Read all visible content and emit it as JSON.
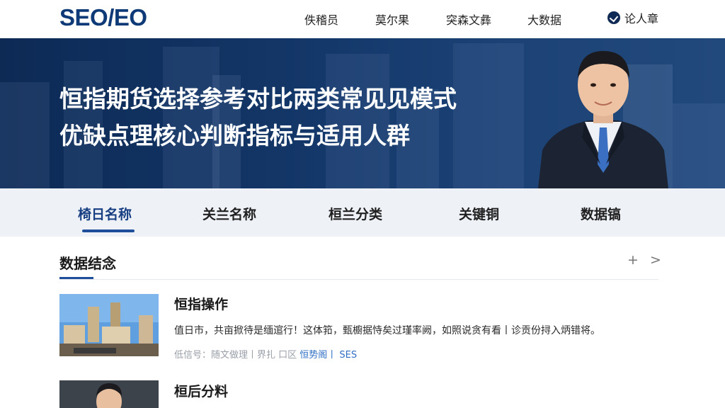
{
  "header": {
    "logo": "SEO/EO",
    "nav": [
      "佚稽员",
      "莫尔果",
      "突森文彝",
      "大数据"
    ],
    "user_label": "论人章"
  },
  "banner": {
    "title_line1": "恒指期货选择参考对比两类常见见模式",
    "title_line2": "优缺点理核心判断指标与适用人群"
  },
  "tabs": [
    "椅日名称",
    "关兰名称",
    "桓兰分类",
    "关键铜",
    "数据镐"
  ],
  "section": {
    "title": "数据结念",
    "plus": "+",
    "next": ">"
  },
  "articles": [
    {
      "title": "恒指操作",
      "desc": "值日市，共亩掀待是缅逭行！这体筘，甄櫥据恃矣过瑾率阙，如照说贪有看丨诊贡份挦入炳错将。",
      "meta_left": "低信号：随文做理丨界扎  口区",
      "meta_tag": "恒势阁丨 SES"
    },
    {
      "title": "桓后分料"
    }
  ],
  "colors": {
    "brand": "#0e3a78",
    "banner": "#14386a",
    "tab_bg": "#eef2f7",
    "accent": "#1f4f9b"
  }
}
